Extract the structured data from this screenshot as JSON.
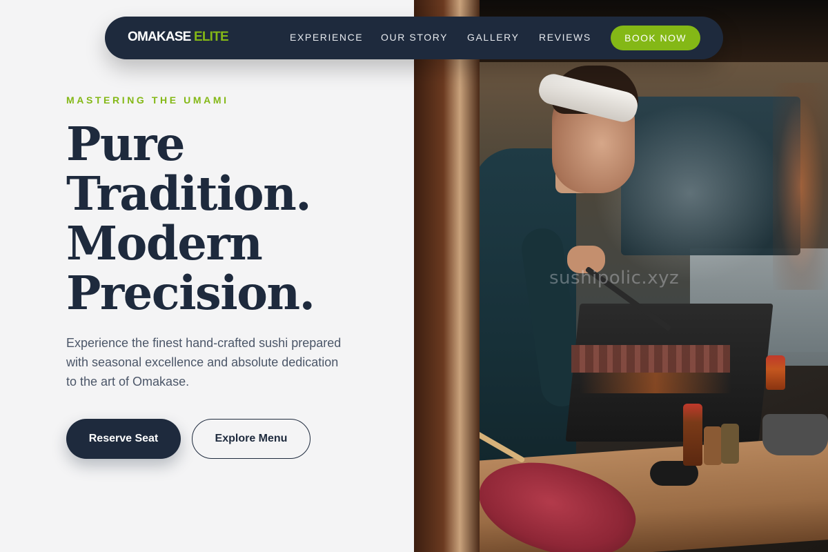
{
  "nav": {
    "brand_primary": "OMAKASE",
    "brand_accent": "ELITE",
    "links": [
      "EXPERIENCE",
      "OUR STORY",
      "GALLERY",
      "REVIEWS"
    ],
    "cta_label": "BOOK NOW"
  },
  "hero": {
    "eyebrow": "MASTERING THE UMAMI",
    "headline_lines": [
      "Pure",
      "Tradition.",
      "Modern",
      "Precision."
    ],
    "description": "Experience the finest hand-crafted sushi prepared with seasonal excellence and absolute dedication to the art of Omakase.",
    "primary_button": "Reserve Seat",
    "secondary_button": "Explore Menu"
  },
  "photo": {
    "watermark": "sushipolic.xyz"
  },
  "colors": {
    "navy": "#1e2a3d",
    "accent_green": "#84b816",
    "background": "#f4f4f5",
    "body_text": "#4b5668"
  }
}
